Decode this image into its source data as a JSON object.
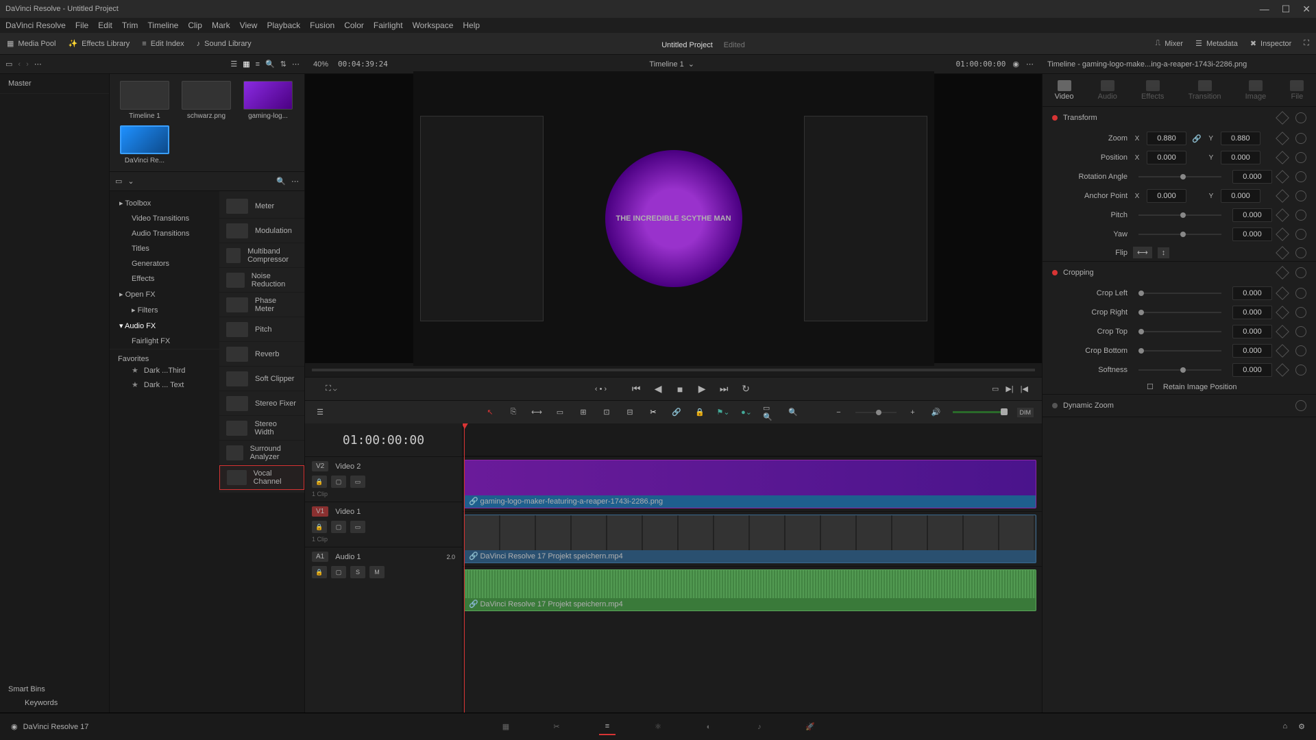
{
  "window": {
    "title": "DaVinci Resolve - Untitled Project"
  },
  "menu": [
    "DaVinci Resolve",
    "File",
    "Edit",
    "Trim",
    "Timeline",
    "Clip",
    "Mark",
    "View",
    "Playback",
    "Fusion",
    "Color",
    "Fairlight",
    "Workspace",
    "Help"
  ],
  "toolbar": {
    "media_pool": "Media Pool",
    "effects_library": "Effects Library",
    "edit_index": "Edit Index",
    "sound_library": "Sound Library",
    "project_title": "Untitled Project",
    "edited": "Edited",
    "mixer": "Mixer",
    "metadata": "Metadata",
    "inspector": "Inspector"
  },
  "secondary": {
    "zoom_pct": "40%",
    "timecode": "00:04:39:24",
    "timeline_name": "Timeline 1",
    "record_tc": "01:00:00:00",
    "inspector_title": "Timeline - gaming-logo-make...ing-a-reaper-1743i-2286.png"
  },
  "master_label": "Master",
  "media": [
    {
      "label": "Timeline 1",
      "kind": "timeline"
    },
    {
      "label": "schwarz.png",
      "kind": "image"
    },
    {
      "label": "gaming-log...",
      "kind": "purple"
    },
    {
      "label": "DaVinci Re...",
      "kind": "blue"
    }
  ],
  "smart_bins": "Smart Bins",
  "keywords": "Keywords",
  "fx_categories": [
    {
      "label": "Toolbox",
      "indent": false
    },
    {
      "label": "Video Transitions",
      "indent": true
    },
    {
      "label": "Audio Transitions",
      "indent": true
    },
    {
      "label": "Titles",
      "indent": true
    },
    {
      "label": "Generators",
      "indent": true
    },
    {
      "label": "Effects",
      "indent": true
    },
    {
      "label": "Open FX",
      "indent": false
    },
    {
      "label": "Filters",
      "indent": true
    },
    {
      "label": "Audio FX",
      "indent": false,
      "active": true
    },
    {
      "label": "Fairlight FX",
      "indent": true
    }
  ],
  "fx_items": [
    "Meter",
    "Modulation",
    "Multiband Compressor",
    "Noise Reduction",
    "Phase Meter",
    "Pitch",
    "Reverb",
    "Soft Clipper",
    "Stereo Fixer",
    "Stereo Width",
    "Surround Analyzer",
    "Vocal Channel"
  ],
  "favorites": {
    "title": "Favorites",
    "items": [
      "Dark ...Third",
      "Dark ... Text"
    ]
  },
  "logo_text": "THE INCREDIBLE SCYTHE MAN",
  "timeline_tc": "01:00:00:00",
  "tracks": {
    "v2": {
      "id": "V2",
      "name": "Video 2",
      "clips": "1 Clip",
      "clip_name": "gaming-logo-maker-featuring-a-reaper-1743i-2286.png"
    },
    "v1": {
      "id": "V1",
      "name": "Video 1",
      "clips": "1 Clip",
      "clip_name": "DaVinci Resolve 17 Projekt speichern.mp4"
    },
    "a1": {
      "id": "A1",
      "name": "Audio 1",
      "ch": "2.0",
      "clip_name": "DaVinci Resolve 17 Projekt speichern.mp4",
      "s": "S",
      "m": "M"
    }
  },
  "inspector": {
    "tabs": [
      "Video",
      "Audio",
      "Effects",
      "Transition",
      "Image",
      "File"
    ],
    "transform": {
      "title": "Transform",
      "zoom": "Zoom",
      "zoom_x": "0.880",
      "zoom_y": "0.880",
      "position": "Position",
      "pos_x": "0.000",
      "pos_y": "0.000",
      "rotation": "Rotation Angle",
      "rot_v": "0.000",
      "anchor": "Anchor Point",
      "anc_x": "0.000",
      "anc_y": "0.000",
      "pitch": "Pitch",
      "pitch_v": "0.000",
      "yaw": "Yaw",
      "yaw_v": "0.000",
      "flip": "Flip"
    },
    "cropping": {
      "title": "Cropping",
      "left": "Crop Left",
      "left_v": "0.000",
      "right": "Crop Right",
      "right_v": "0.000",
      "top": "Crop Top",
      "top_v": "0.000",
      "bottom": "Crop Bottom",
      "bottom_v": "0.000",
      "soft": "Softness",
      "soft_v": "0.000",
      "retain": "Retain Image Position"
    },
    "dynamic": "Dynamic Zoom"
  },
  "footer": {
    "app": "DaVinci Resolve 17"
  },
  "dim": "DIM"
}
